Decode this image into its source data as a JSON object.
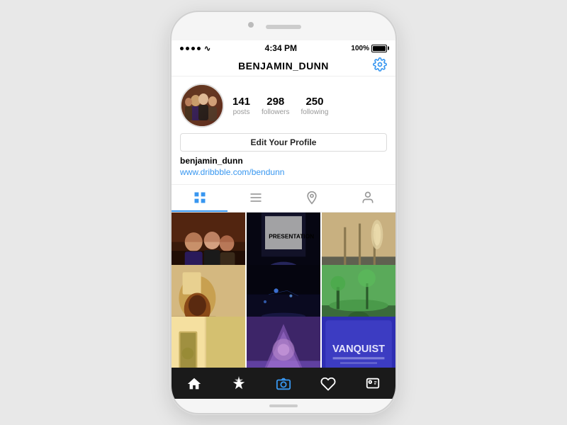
{
  "phone": {
    "status_bar": {
      "dots": 4,
      "wifi": "wifi",
      "time": "4:34 PM",
      "battery_percent": "100%"
    },
    "header": {
      "username": "BENJAMIN_DUNN",
      "gear_icon": "gear"
    },
    "profile": {
      "stats": [
        {
          "number": "141",
          "label": "posts"
        },
        {
          "number": "298",
          "label": "followers"
        },
        {
          "number": "250",
          "label": "following"
        }
      ],
      "edit_button": "Edit Your Profile",
      "bio_username": "benjamin_dunn",
      "bio_link": "www.dribbble.com/bendunn"
    },
    "tabs": [
      {
        "id": "grid",
        "label": "grid",
        "active": true
      },
      {
        "id": "list",
        "label": "list",
        "active": false
      },
      {
        "id": "location",
        "label": "location",
        "active": false
      },
      {
        "id": "tagged",
        "label": "tagged",
        "active": false
      }
    ],
    "photos": [
      {
        "id": 1,
        "class": "photo-1"
      },
      {
        "id": 2,
        "class": "photo-2"
      },
      {
        "id": 3,
        "class": "photo-3"
      },
      {
        "id": 4,
        "class": "photo-4"
      },
      {
        "id": 5,
        "class": "photo-5"
      },
      {
        "id": 6,
        "class": "photo-6"
      },
      {
        "id": 7,
        "class": "photo-7"
      },
      {
        "id": 8,
        "class": "photo-8"
      },
      {
        "id": 9,
        "class": "photo-9"
      }
    ],
    "bottom_nav": [
      {
        "id": "home",
        "label": "home"
      },
      {
        "id": "explore",
        "label": "explore"
      },
      {
        "id": "camera",
        "label": "camera",
        "active": true
      },
      {
        "id": "heart",
        "label": "heart"
      },
      {
        "id": "profile",
        "label": "profile"
      }
    ]
  }
}
